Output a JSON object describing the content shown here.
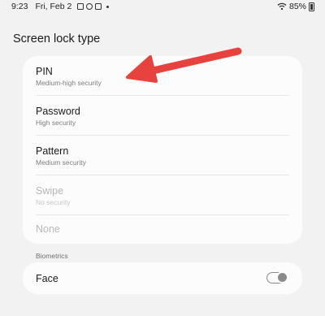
{
  "status_bar": {
    "time": "9:23",
    "date": "Fri, Feb 2",
    "battery": "85%"
  },
  "page": {
    "title": "Screen lock type"
  },
  "lock_options": [
    {
      "title": "PIN",
      "subtitle": "Medium-high security",
      "enabled": true
    },
    {
      "title": "Password",
      "subtitle": "High security",
      "enabled": true
    },
    {
      "title": "Pattern",
      "subtitle": "Medium security",
      "enabled": true
    },
    {
      "title": "Swipe",
      "subtitle": "No security",
      "enabled": false
    },
    {
      "title": "None",
      "enabled": false
    }
  ],
  "biometrics": {
    "section_label": "Biometrics",
    "face_label": "Face",
    "face_enabled": false
  },
  "colors": {
    "annotation_arrow": "#e8423f",
    "toggle_off": "#8a8a8a"
  }
}
